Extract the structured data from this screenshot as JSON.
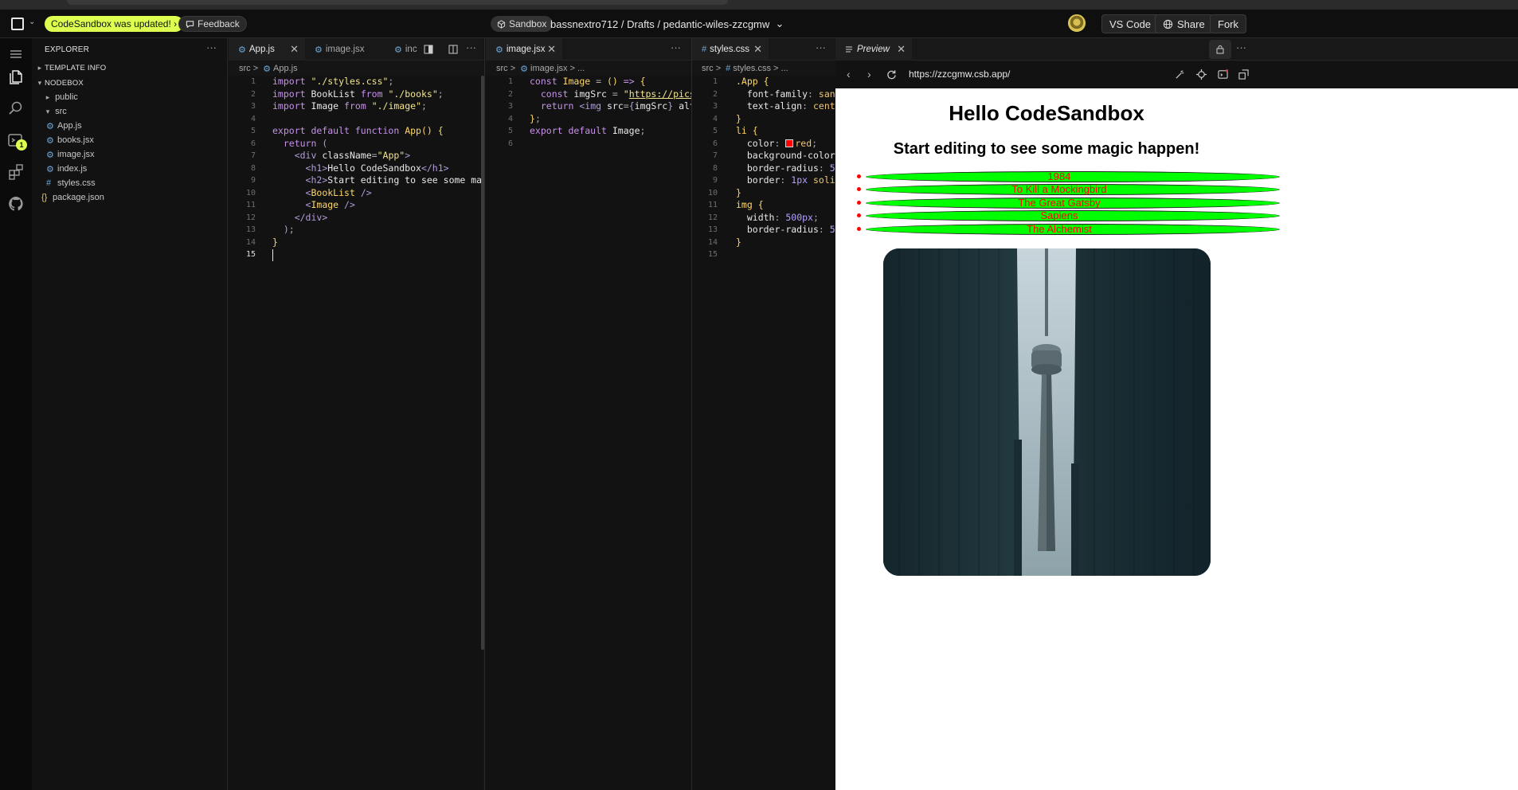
{
  "topbar": {
    "update_label": "CodeSandbox was updated!",
    "update_chevron": "›",
    "feedback_label": "Feedback",
    "sandbox_label": "Sandbox",
    "breadcrumb": "bassnextro712 / Drafts / pedantic-wiles-zzcgmw",
    "breadcrumb_caret": "⌄",
    "vscode_label": "VS Code",
    "share_label": "Share",
    "fork_label": "Fork"
  },
  "activity": {
    "run_badge": "1"
  },
  "explorer": {
    "title": "EXPLORER",
    "more": "···",
    "sections": [
      {
        "label": "TEMPLATE INFO",
        "expanded": false
      },
      {
        "label": "NODEBOX",
        "expanded": true
      }
    ],
    "items": [
      {
        "label": "public",
        "type": "folder",
        "expanded": false
      },
      {
        "label": "src",
        "type": "folder",
        "expanded": true
      },
      {
        "label": "App.js",
        "type": "js-file"
      },
      {
        "label": "books.jsx",
        "type": "jsx-file"
      },
      {
        "label": "image.jsx",
        "type": "jsx-file"
      },
      {
        "label": "index.js",
        "type": "js-file"
      },
      {
        "label": "styles.css",
        "type": "css-file"
      },
      {
        "label": "package.json",
        "type": "json-file"
      }
    ]
  },
  "pane1": {
    "tabs": [
      {
        "label": "App.js",
        "active": true,
        "close": "✕"
      },
      {
        "label": "image.jsx",
        "active": false
      },
      {
        "label": "inc",
        "active": false
      }
    ],
    "more": "···",
    "breadcrumb": {
      "folder": "src",
      "sep": ">",
      "file": "App.js"
    },
    "cursor_line": 15
  },
  "pane2": {
    "tabs": [
      {
        "label": "image.jsx",
        "active": true,
        "close": "✕"
      }
    ],
    "more": "···",
    "breadcrumb": {
      "folder": "src",
      "sep": ">",
      "file": "image.jsx",
      "rest": "> ..."
    }
  },
  "pane3": {
    "tabs": [
      {
        "label": "styles.css",
        "active": true,
        "close": "✕"
      }
    ],
    "more": "···",
    "breadcrumb": {
      "folder": "src",
      "sep": ">",
      "file": "styles.css",
      "rest": "> ..."
    }
  },
  "preview": {
    "tab_label": "Preview",
    "close": "✕",
    "url": "https://zzcgmw.csb.app/",
    "h1": "Hello CodeSandbox",
    "h2": "Start editing to see some magic happen!",
    "books": [
      "1984",
      "To Kill a Mockingbird",
      "The Great Gatsby",
      "Sapiens",
      "The Alchemist"
    ]
  },
  "colors": {
    "accent": "#dcff50",
    "li_text": "#ff0000",
    "li_bg": "#00ff00"
  }
}
